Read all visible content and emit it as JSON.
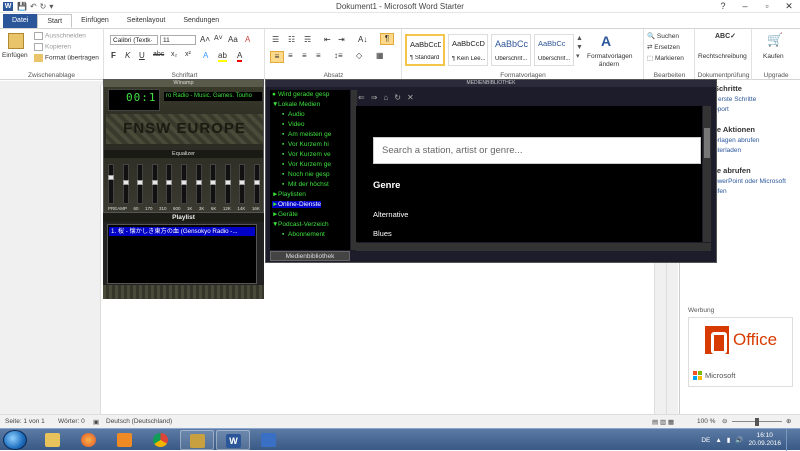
{
  "window": {
    "title": "Dokument1 - Microsoft Word Starter",
    "help": "?"
  },
  "tabs": [
    {
      "label": "Datei"
    },
    {
      "label": "Start"
    },
    {
      "label": "Einfügen"
    },
    {
      "label": "Seitenlayout"
    },
    {
      "label": "Sendungen"
    }
  ],
  "ribbon": {
    "clipboard": {
      "paste": "Einfügen",
      "cut": "Ausschneiden",
      "copy": "Kopieren",
      "format_painter": "Format übertragen",
      "group": "Zwischenablage"
    },
    "font": {
      "family": "Calibri (Textk·",
      "size": "11",
      "group": "Schriftart",
      "bold": "F",
      "italic": "K",
      "underline": "U",
      "strike": "abc"
    },
    "paragraph": {
      "group": "Absatz"
    },
    "styles": {
      "items": [
        {
          "preview": "AaBbCcDc",
          "name": "¶ Standard"
        },
        {
          "preview": "AaBbCcDc",
          "name": "¶ Kein Lee..."
        },
        {
          "preview": "AaBbCc",
          "name": "Überschrif..."
        },
        {
          "preview": "AaBbCc",
          "name": "Überschrif..."
        }
      ],
      "change": "Formatvorlagen ändern",
      "group": "Formatvorlagen"
    },
    "editing": {
      "find": "Suchen",
      "replace": "Ersetzen",
      "select": "Markieren",
      "group": "Bearbeiten"
    },
    "proofing": {
      "spell": "Rechtschreibung",
      "group": "Dokumentprüfung"
    },
    "upgrade": {
      "buy": "Kaufen",
      "group": "Upgrade"
    }
  },
  "taskpane": {
    "line1": "Schritte",
    "line2": "r erste Schritte",
    "line3": "pport",
    "h2": "re Aktionen",
    "line4": "orlagen abrufen",
    "line5": "nterladen",
    "h3": "re abrufen",
    "line6": "owerPoint oder Microsoft",
    "line7": "ufen",
    "ad_label": "Werbung",
    "office": "Office",
    "microsoft": "Microsoft"
  },
  "statusbar": {
    "page": "Seite: 1 von 1",
    "words": "Wörter: 0",
    "lang": "Deutsch (Deutschland)",
    "zoom": "100 %"
  },
  "winamp": {
    "title": "Winamp",
    "time": "00:1",
    "marquee": "ro Radio - Music. Games. Touho",
    "logo": "FNSW EUROPE",
    "eq_title": "Equalizer",
    "eq_labels": [
      "PREAMP",
      "60",
      "170",
      "310",
      "600",
      "1K",
      "3K",
      "6K",
      "12K",
      "14K",
      "16K"
    ],
    "eq_levels": [
      0.72,
      0.55,
      0.55,
      0.55,
      0.55,
      0.55,
      0.55,
      0.55,
      0.55,
      0.55,
      0.55
    ],
    "playlist_title": "Playlist",
    "playlist_item": "1. 桜 - 懐かしき東方の血 (Gensokyo Radio -..."
  },
  "medialib": {
    "title": "MEDIENBIBLIOTHEK",
    "tree": [
      {
        "label": "Wird gerade gesp",
        "kind": "now",
        "sel": false
      },
      {
        "label": "Lokale Medien",
        "kind": "open",
        "sel": false
      },
      {
        "label": "Audio",
        "kind": "child",
        "sel": false
      },
      {
        "label": "Video",
        "kind": "child",
        "sel": false
      },
      {
        "label": "Am meisten ge",
        "kind": "child",
        "sel": false
      },
      {
        "label": "Vor Kurzem hi",
        "kind": "child",
        "sel": false
      },
      {
        "label": "Vor Kurzem ve",
        "kind": "child",
        "sel": false
      },
      {
        "label": "Vor Kurzem ge",
        "kind": "child",
        "sel": false
      },
      {
        "label": "Noch nie gesp",
        "kind": "child",
        "sel": false
      },
      {
        "label": "Mit der höchst",
        "kind": "child",
        "sel": false
      },
      {
        "label": "Playlisten",
        "kind": "closed",
        "sel": false
      },
      {
        "label": "Online-Dienste",
        "kind": "closed",
        "sel": true
      },
      {
        "label": "Geräte",
        "kind": "closed",
        "sel": false
      },
      {
        "label": "Podcast-Verzeich",
        "kind": "open",
        "sel": false
      },
      {
        "label": "Abonnement",
        "kind": "child",
        "sel": false
      }
    ],
    "button": "Medienbibliothek",
    "search_placeholder": "Search a station, artist or genre...",
    "genre_heading": "Genre",
    "genres": [
      "Alternative",
      "Blues"
    ]
  },
  "taskbar": {
    "lang": "DE",
    "time": "16:10",
    "date": "20.09.2016"
  }
}
